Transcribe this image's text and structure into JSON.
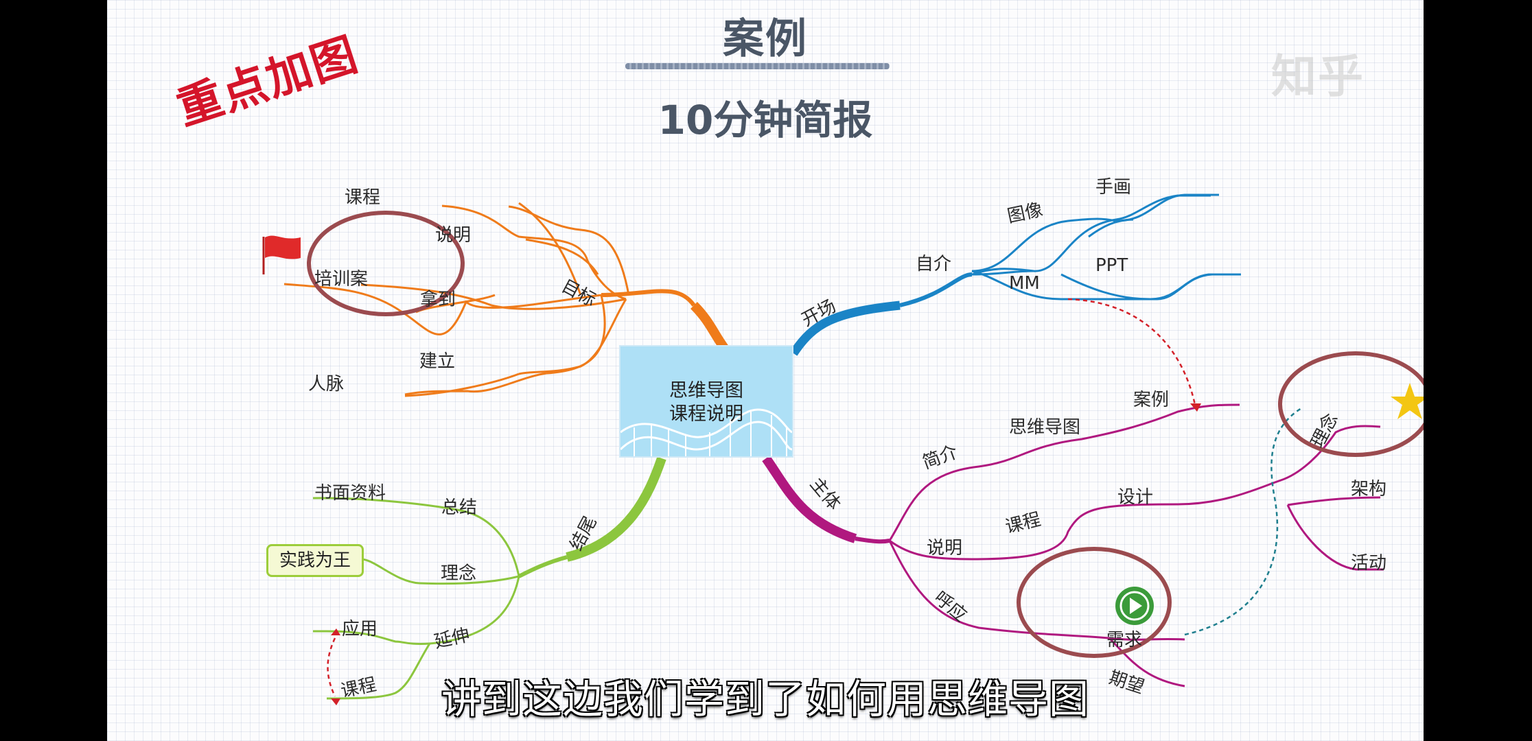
{
  "title": "案例",
  "subtitle": "10分钟简报",
  "stamp": "重点加图",
  "watermark": "知乎",
  "caption": "讲到这边我们学到了如何用思维导图",
  "center": {
    "line1": "思维导图",
    "line2": "课程说明"
  },
  "branches": {
    "goal": {
      "label": "目标",
      "color": "#ef7b1a",
      "kc": "课程",
      "sm": "说明",
      "px": "培训案",
      "nd": "拿到",
      "jl": "建立",
      "rm": "人脉"
    },
    "opening": {
      "label": "开场",
      "color": "#1a84c6",
      "zj": "自介",
      "tx": "图像",
      "sh": "手画",
      "mm": "MM",
      "ppt": "PPT"
    },
    "body": {
      "label": "主体",
      "color": "#b0187f",
      "jj": "简介",
      "swdt": "思维导图",
      "al": "案例",
      "sm": "说明",
      "kc": "课程",
      "sj": "设计",
      "ln": "理念",
      "jg": "架构",
      "hd": "活动",
      "hy": "呼应",
      "xq": "需求",
      "qw": "期望"
    },
    "ending": {
      "label": "结尾",
      "color": "#8cc63e",
      "zj": "总结",
      "smzl": "书面资料",
      "ln": "理念",
      "sjwz": "实践为王",
      "ys": "延伸",
      "yy": "应用",
      "kc": "课程"
    }
  },
  "colors": {
    "circle": "#9b4b4f",
    "flag": "#e02a2a",
    "star": "#f3c613",
    "play": "#3b9b3a"
  }
}
